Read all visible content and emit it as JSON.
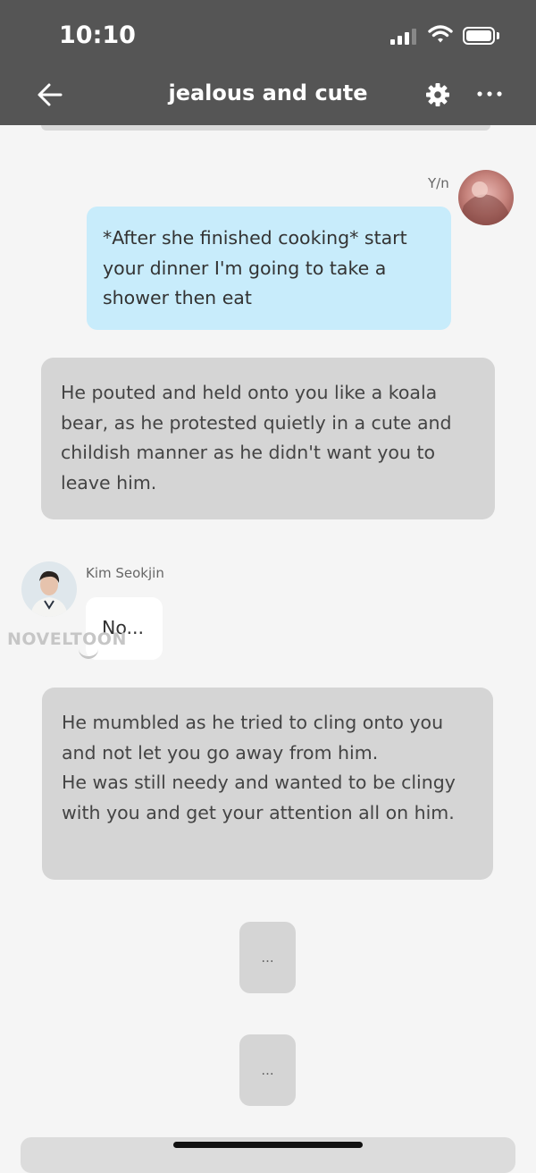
{
  "status_bar": {
    "time": "10:10",
    "icons": [
      "cellular-signal-icon",
      "wifi-icon",
      "battery-icon"
    ]
  },
  "header": {
    "title": "jealous and cute",
    "back_icon": "arrow-left-icon",
    "settings_icon": "gear-icon",
    "more_icon": "more-horizontal-icon"
  },
  "colors": {
    "header_bg": "#555555",
    "user_bubble": "#c8ecfb",
    "narration_bubble": "#d5d5d5",
    "page_bg": "#f5f5f5"
  },
  "messages": [
    {
      "type": "user",
      "sender": "Y/n",
      "text": "*After she finished cooking* start your dinner I'm going to take a shower then eat"
    },
    {
      "type": "narration",
      "text": "He pouted and held onto you like a koala bear, as he protested quietly in a cute and childish manner as he didn't want you to leave him."
    },
    {
      "type": "character",
      "sender": "Kim Seokjin",
      "text": "No..."
    },
    {
      "type": "narration",
      "text": "He mumbled as he tried to cling onto you and not let you go away from him.\nHe was still needy and wanted to be clingy with you and get your attention all on him."
    },
    {
      "type": "narration",
      "text": "..."
    },
    {
      "type": "narration",
      "text": "..."
    }
  ],
  "watermark": "NOVELTOON"
}
